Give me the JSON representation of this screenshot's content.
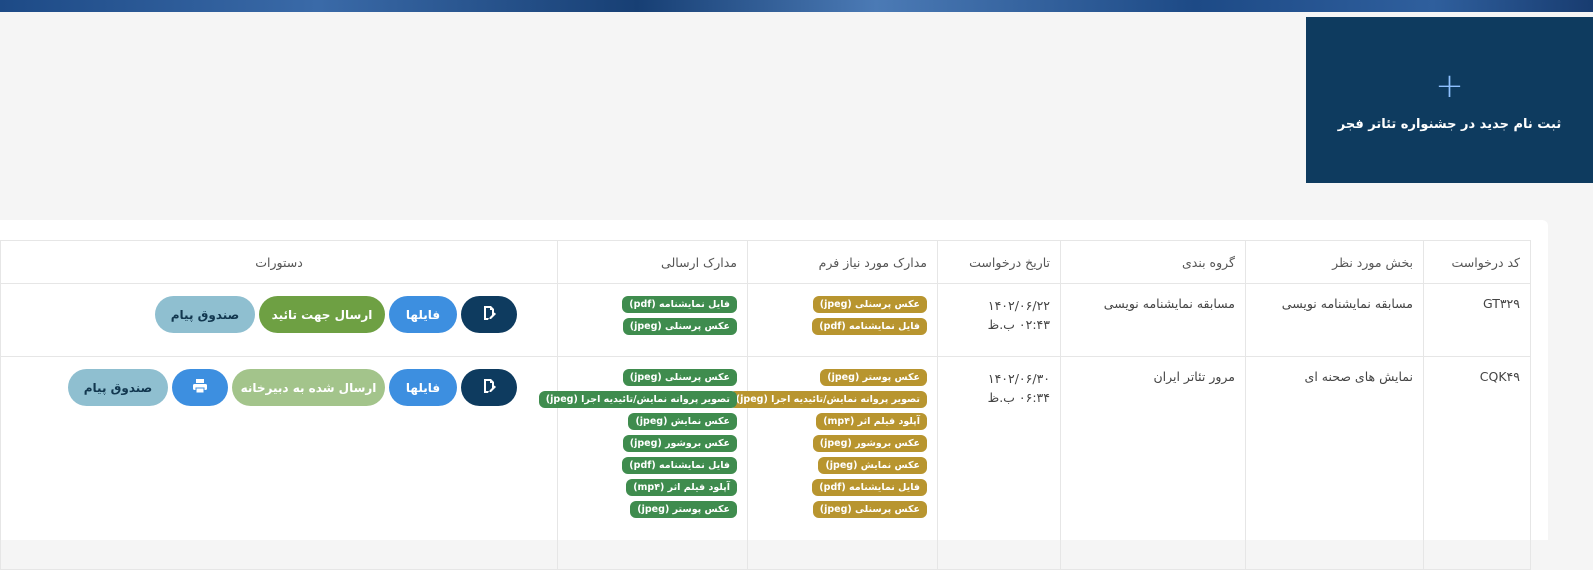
{
  "new_registration": {
    "label": "ثبت نام جدید در جشنواره تئاتر فجر",
    "icon": "plus-icon"
  },
  "table": {
    "headers": {
      "code": "کد درخواست",
      "section": "بخش مورد نظر",
      "group": "گروه بندی",
      "date": "تاریخ درخواست",
      "required_docs": "مدارک مورد نیاز فرم",
      "sent_docs": "مدارک ارسالی",
      "actions": "دستورات"
    },
    "rows": [
      {
        "code": "GT۳۲۹",
        "section": "مسابقه نمایشنامه نویسی",
        "group": "مسابقه نمایشنامه نویسی",
        "date": "۱۴۰۲/۰۶/۲۲",
        "time": "۰۲:۴۳ ب.ظ",
        "required_docs": [
          "عکس پرسنلی (jpeg)",
          "فایل نمایشنامه (pdf)"
        ],
        "sent_docs": [
          "فایل نمایشنامه (pdf)",
          "عکس پرسنلی (jpeg)"
        ],
        "actions": {
          "files": "فایلها",
          "send": "ارسال جهت تائید",
          "inbox": "صندوق پیام"
        }
      },
      {
        "code": "CQK۴۹",
        "section": "نمایش های صحنه ای",
        "group": "مرور تئاتر ایران",
        "date": "۱۴۰۲/۰۶/۳۰",
        "time": "۰۶:۳۴ ب.ظ",
        "required_docs": [
          "عکس پوستر (jpeg)",
          "تصویر پروانه نمایش/تائیدیه اجرا (jpeg)",
          "آپلود فیلم اثر (mp۴)",
          "عکس بروشور (jpeg)",
          "عکس نمایش (jpeg)",
          "فایل نمایشنامه (pdf)",
          "عکس پرسنلی (jpeg)"
        ],
        "sent_docs": [
          "عکس پرسنلی (jpeg)",
          "تصویر پروانه نمایش/تائیدیه اجرا (jpeg)",
          "عکس نمایش (jpeg)",
          "عکس بروشور (jpeg)",
          "فایل نمایشنامه (pdf)",
          "آپلود فیلم اثر (mp۴)",
          "عکس پوستر (jpeg)"
        ],
        "actions": {
          "files": "فایلها",
          "sent_to_secretariat": "ارسال شده به دبیرخانه",
          "inbox": "صندوق پیام"
        }
      }
    ]
  },
  "colors": {
    "primary_dark": "#0e3b5f",
    "required_badge": "#b8952f",
    "sent_badge": "#3f8c4e",
    "files_button": "#3d8fe0",
    "send_button": "#6ea043",
    "sent_button": "#a3c48b",
    "inbox_button": "#8fbfd0"
  },
  "icons": {
    "edit": "edit-document-icon",
    "print": "printer-icon"
  }
}
